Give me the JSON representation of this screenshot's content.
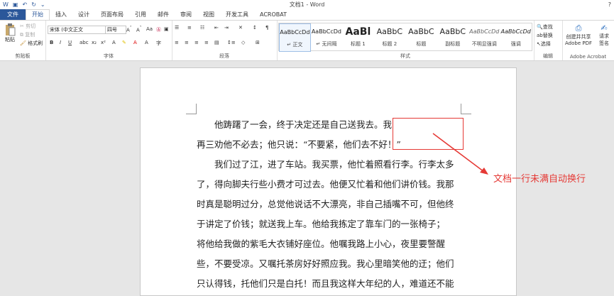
{
  "titlebar": {
    "title": "文档1 - Word",
    "help": "?"
  },
  "tabs": [
    {
      "label": "文件"
    },
    {
      "label": "开始"
    },
    {
      "label": "插入"
    },
    {
      "label": "设计"
    },
    {
      "label": "页面布局"
    },
    {
      "label": "引用"
    },
    {
      "label": "邮件"
    },
    {
      "label": "审阅"
    },
    {
      "label": "视图"
    },
    {
      "label": "开发工具"
    },
    {
      "label": "ACROBAT"
    }
  ],
  "clipboard": {
    "paste": "粘贴",
    "cut": "剪切",
    "copy": "复制",
    "format_painter": "格式刷",
    "label": "剪贴板"
  },
  "font": {
    "name": "宋体 (中文正文",
    "size": "四号",
    "label": "字体",
    "b": "B",
    "i": "I",
    "u": "U"
  },
  "paragraph": {
    "label": "段落"
  },
  "styles": {
    "label": "样式",
    "items": [
      {
        "sample": "AaBbCcDd",
        "name": "↵ 正文"
      },
      {
        "sample": "AaBbCcDd",
        "name": "↵ 无间隔"
      },
      {
        "sample": "AaBl",
        "name": "标题 1"
      },
      {
        "sample": "AaBbC",
        "name": "标题 2"
      },
      {
        "sample": "AaBbC",
        "name": "标题"
      },
      {
        "sample": "AaBbC",
        "name": "副标题"
      },
      {
        "sample": "AaBbCcDd",
        "name": "不明显强调"
      },
      {
        "sample": "AaBbCcDd",
        "name": "强调"
      }
    ]
  },
  "editing": {
    "find": "查找",
    "replace": "替换",
    "select": "选择",
    "label": "编辑"
  },
  "acrobat": {
    "create_share": "创建并共享",
    "create_share2": "Adobe PDF",
    "request": "请求",
    "request2": "签名",
    "label": "Adobe Acrobat"
  },
  "document": {
    "lines": [
      "他踌躇了一会，终于决定还是自己送我去。我",
      "再三劝他不必去；他只说：“不要紧，他们去不好！”",
      "我们过了江，进了车站。我买票，他忙着照看行李。行李太多",
      "了，得向脚夫行些小费才可过去。他便又忙着和他们讲价钱。我那",
      "时真是聪明过分，总觉他说话不大漂亮，非自己插嘴不可，但他终",
      "于讲定了价钱；就送我上车。他给我拣定了靠车门的一张椅子；",
      "将他给我做的紫毛大衣铺好座位。他嘱我路上小心，夜里要警醒",
      "些，不要受凉。又嘱托茶房好好照应我。我心里暗笑他的迂；他们",
      "只认得钱，托他们只是白托！而且我这样大年纪的人，难道还不能"
    ]
  },
  "annotation": {
    "text": "文档一行未满自动换行",
    "color": "#e53935"
  }
}
